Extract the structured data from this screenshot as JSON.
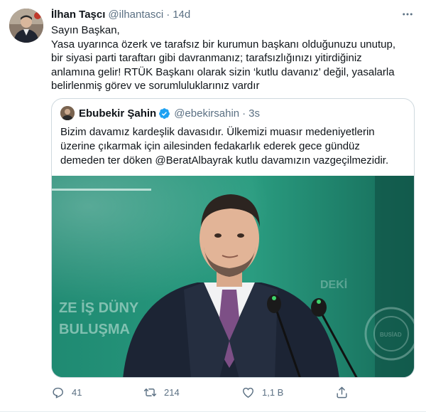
{
  "tweet": {
    "author_name": "İlhan Taşcı",
    "author_handle": "@ilhantasci",
    "separator": "·",
    "time": "14d",
    "body_lines": [
      "Sayın Başkan,",
      "Yasa uyarınca özerk ve tarafsız bir kurumun başkanı olduğunuzu unutup,",
      "bir siyasi parti taraftarı gibi davranmanız; tarafsızlığınızı yitirdiğiniz",
      "anlamına gelir! RTÜK Başkanı olarak sizin ‘kutlu davanız’ değil, yasalarla",
      "belirlenmiş görev ve sorumluluklarınız vardır"
    ],
    "more_icon": "more-horizontal-icon"
  },
  "quoted": {
    "author_name": "Ebubekir Şahin",
    "author_handle": "@ebekirsahin",
    "separator": "·",
    "time": "3s",
    "verified_icon": "verified-badge-icon",
    "text_lines": [
      "Bizim davamız kardeşlik davasıdır. Ülkemizi muasır medeniyetlerin",
      "üzerine çıkarmak için ailesinden fedakarlık ederek gece gündüz",
      "demeden ter döken @BeratAlbayrak kutlu davamızın vazgeçilmezidir."
    ],
    "media": {
      "backdrop_text_1": "ZE İŞ DÜNY",
      "backdrop_text_2": "BULUŞMA",
      "backdrop_text_3": "DEKİ",
      "backdrop_text_4": "BUSİAD"
    }
  },
  "actions": {
    "reply_count": "41",
    "retweet_count": "214",
    "like_count": "1,1 B",
    "icons": [
      "reply-icon",
      "retweet-icon",
      "like-icon",
      "share-icon"
    ]
  },
  "colors": {
    "text_primary": "#0f1419",
    "text_secondary": "#5b7083",
    "verified_blue": "#1da1f2",
    "border": "#cfd9de"
  }
}
